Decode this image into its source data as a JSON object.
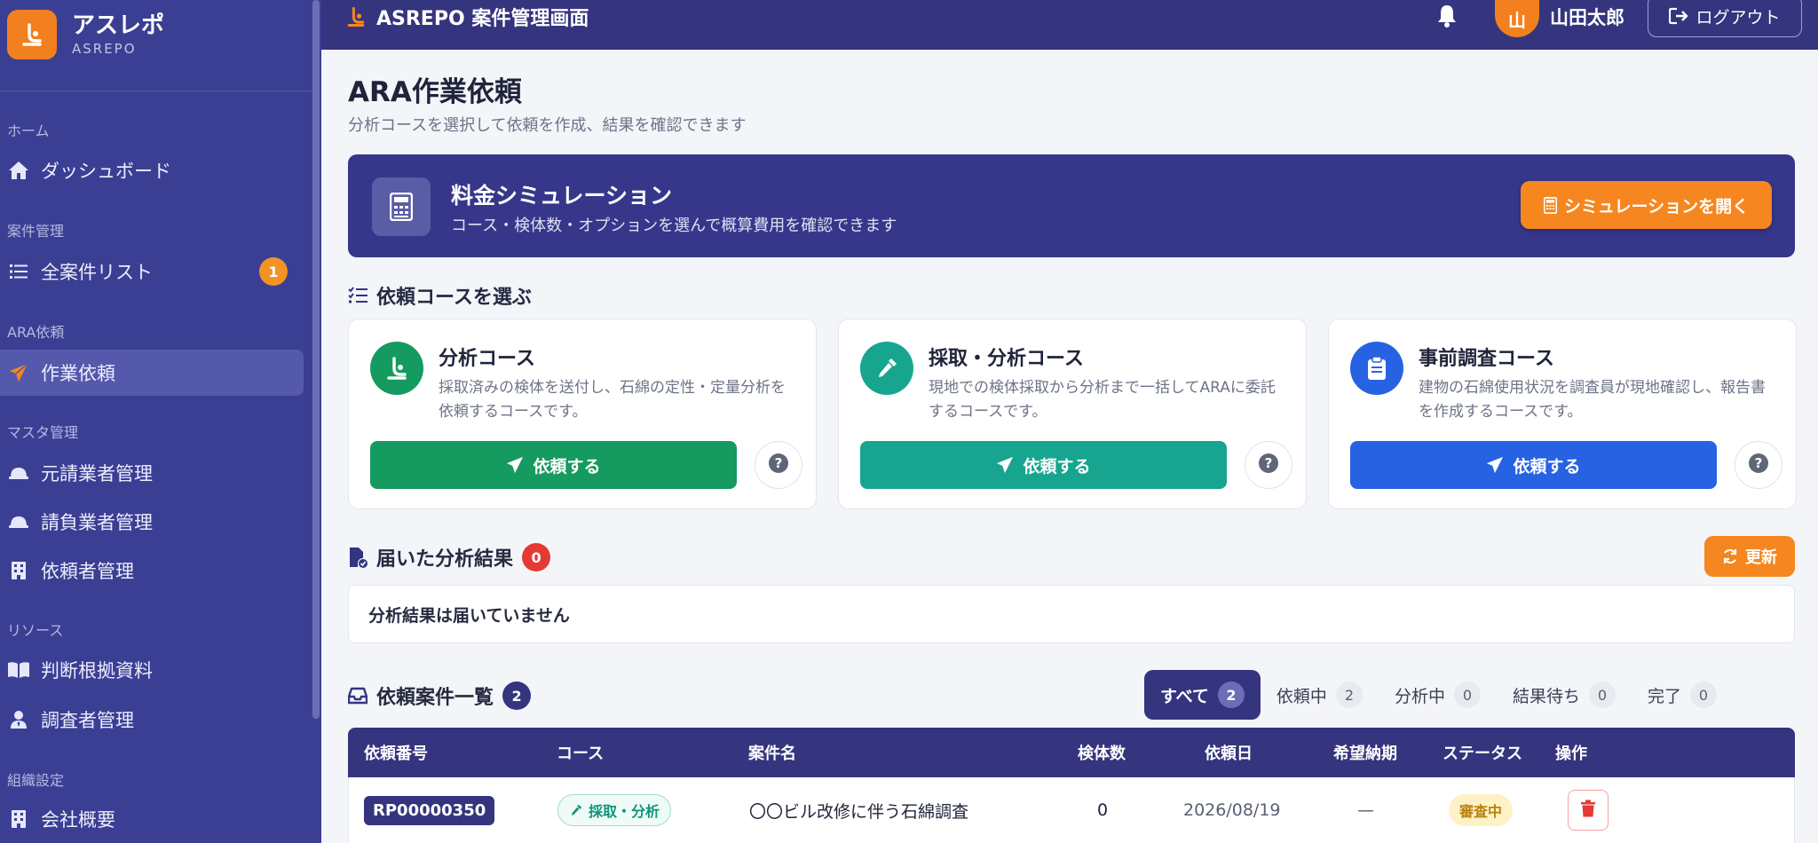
{
  "sidebar": {
    "brand_name": "アスレポ",
    "brand_sub": "ASREPO",
    "sections": {
      "home": "ホーム",
      "cases": "案件管理",
      "ara": "ARA依頼",
      "master": "マスタ管理",
      "resources": "リソース",
      "org": "組織設定"
    },
    "items": {
      "dashboard": "ダッシュボード",
      "all_cases": "全案件リスト",
      "all_cases_badge": "1",
      "work_request": "作業依頼",
      "prime_contractor": "元請業者管理",
      "subcontractor": "請負業者管理",
      "requester": "依頼者管理",
      "reference": "判断根拠資料",
      "investigator": "調査者管理",
      "company": "会社概要"
    }
  },
  "header": {
    "title": "ASREPO 案件管理画面",
    "avatar_initial": "山",
    "user_name": "山田太郎",
    "logout_label": "ログアウト"
  },
  "page": {
    "title": "ARA作業依頼",
    "subtitle": "分析コースを選択して依頼を作成、結果を確認できます"
  },
  "simulation": {
    "title": "料金シミュレーション",
    "description": "コース・検体数・オプションを選んで概算費用を確認できます",
    "button_label": "シミュレーションを開く"
  },
  "course_section": {
    "heading": "依頼コースを選ぶ",
    "courses": [
      {
        "title": "分析コース",
        "description": "採取済みの検体を送付し、石綿の定性・定量分析を依頼するコースです。",
        "button_label": "依頼する",
        "color": "#159a5f"
      },
      {
        "title": "採取・分析コース",
        "description": "現地での検体採取から分析まで一括してARAに委託するコースです。",
        "button_label": "依頼する",
        "color": "#17a58f"
      },
      {
        "title": "事前調査コース",
        "description": "建物の石綿使用状況を調査員が現地確認し、報告書を作成するコースです。",
        "button_label": "依頼する",
        "color": "#2762e3"
      }
    ]
  },
  "results": {
    "heading": "届いた分析結果",
    "count": "0",
    "refresh_label": "更新",
    "empty_message": "分析結果は届いていません"
  },
  "requests": {
    "heading": "依頼案件一覧",
    "count": "2",
    "tabs": [
      {
        "label": "すべて",
        "count": "2",
        "active": true
      },
      {
        "label": "依頼中",
        "count": "2",
        "active": false
      },
      {
        "label": "分析中",
        "count": "0",
        "active": false
      },
      {
        "label": "結果待ち",
        "count": "0",
        "active": false
      },
      {
        "label": "完了",
        "count": "0",
        "active": false
      }
    ],
    "columns": {
      "request_no": "依頼番号",
      "course": "コース",
      "case_name": "案件名",
      "samples": "検体数",
      "request_date": "依頼日",
      "desired_date": "希望納期",
      "status": "ステータス",
      "actions": "操作"
    },
    "rows": [
      {
        "request_no": "RP00000350",
        "course": "採取・分析",
        "case_name": "〇〇ビル改修に伴う石綿調査",
        "samples": "0",
        "request_date": "2026/08/19",
        "desired_date": "—",
        "status": "審査中"
      }
    ]
  },
  "colors": {
    "sidebar": "#3b3f94",
    "header": "#34357e",
    "accent_orange": "#f6861f",
    "danger": "#e53935"
  }
}
